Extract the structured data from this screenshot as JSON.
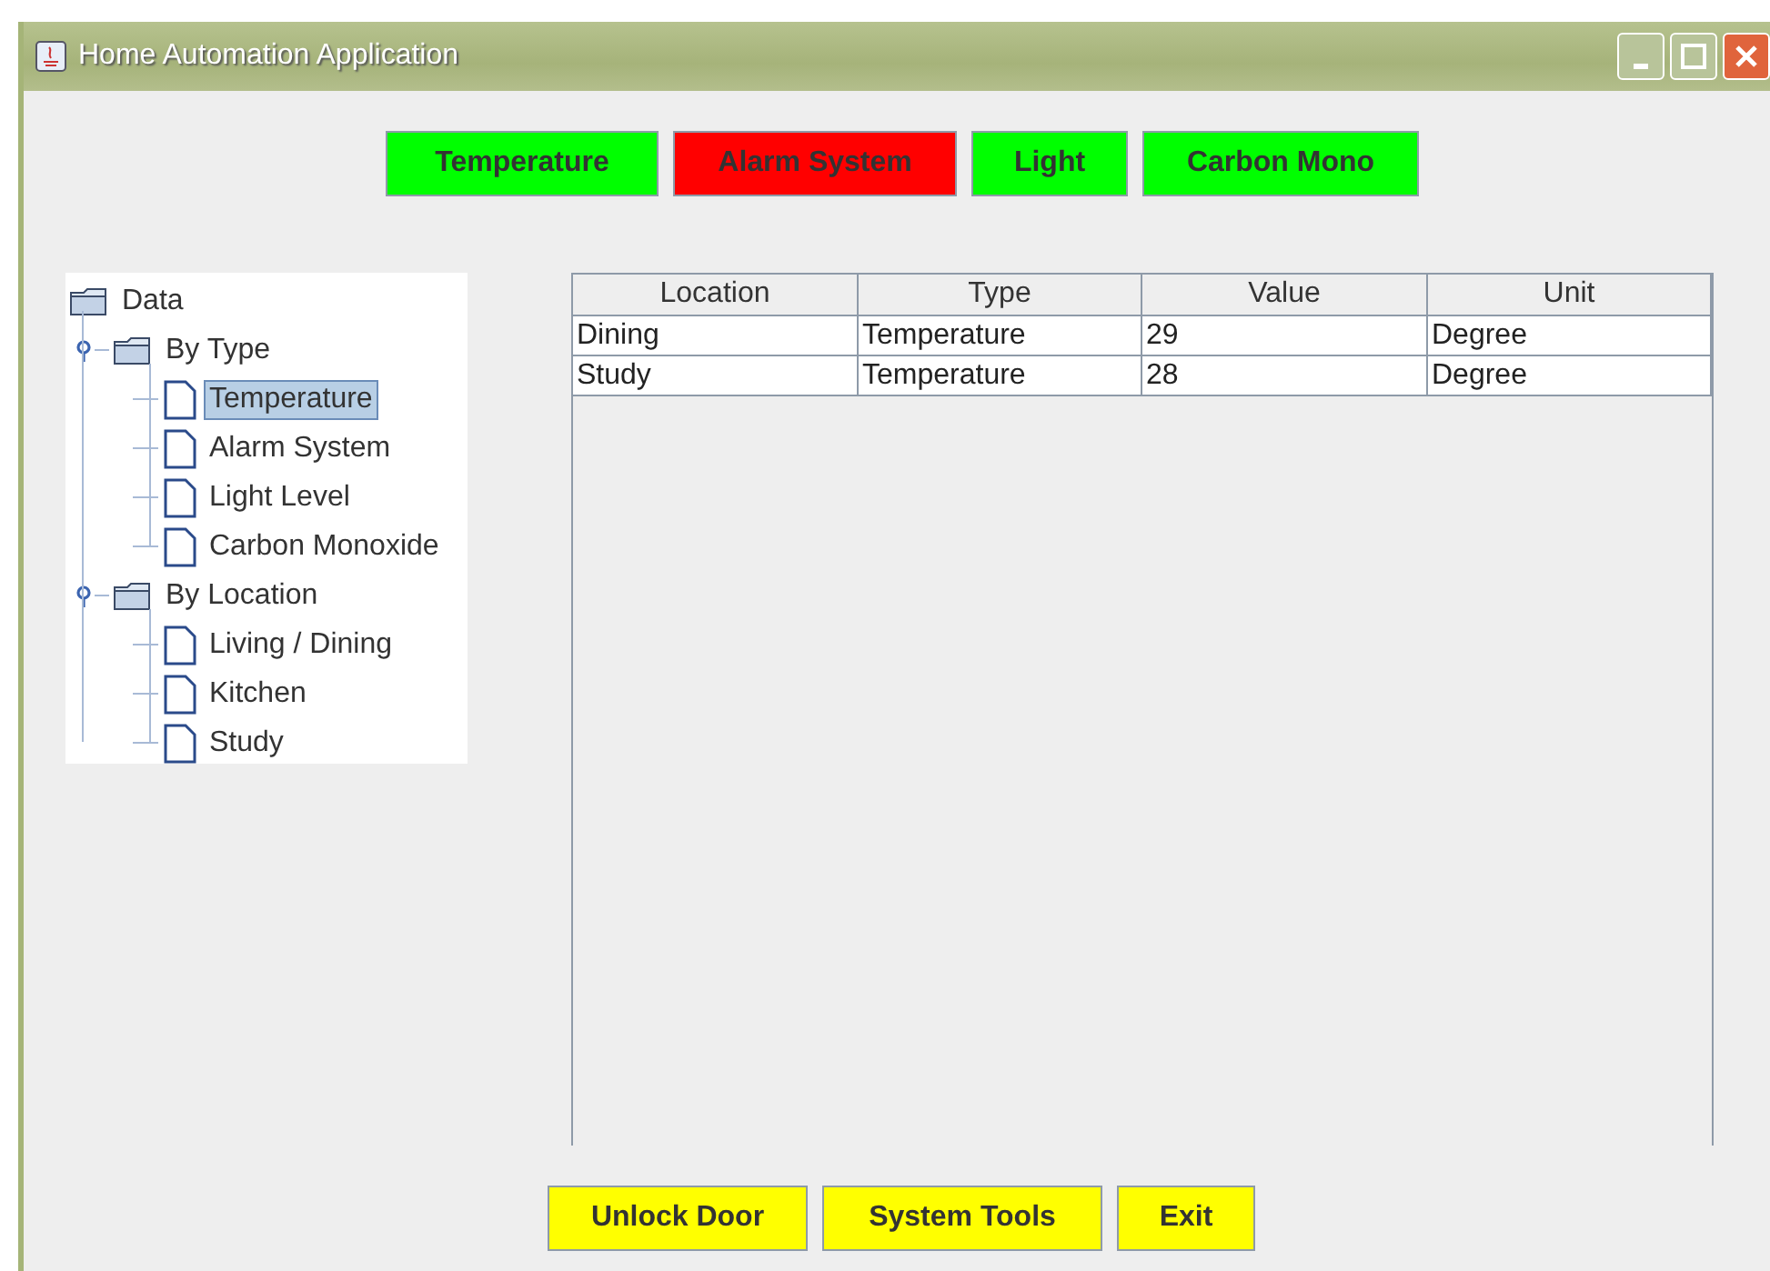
{
  "window": {
    "title": "Home Automation Application"
  },
  "sensor_buttons": [
    {
      "label": "Temperature",
      "color": "#00ff00"
    },
    {
      "label": "Alarm System",
      "color": "#ff0000"
    },
    {
      "label": "Light",
      "color": "#00ff00"
    },
    {
      "label": "Carbon Mono",
      "color": "#00ff00"
    }
  ],
  "tree": {
    "label": "Data",
    "kind": "folder",
    "selected": false,
    "children": [
      {
        "label": "By Type",
        "kind": "folder",
        "selected": false,
        "children": [
          {
            "label": "Temperature",
            "kind": "leaf",
            "selected": true
          },
          {
            "label": "Alarm System",
            "kind": "leaf",
            "selected": false
          },
          {
            "label": "Light Level",
            "kind": "leaf",
            "selected": false
          },
          {
            "label": "Carbon Monoxide",
            "kind": "leaf",
            "selected": false
          }
        ]
      },
      {
        "label": "By Location",
        "kind": "folder",
        "selected": false,
        "children": [
          {
            "label": "Living / Dining",
            "kind": "leaf",
            "selected": false
          },
          {
            "label": "Kitchen",
            "kind": "leaf",
            "selected": false
          },
          {
            "label": "Study",
            "kind": "leaf",
            "selected": false
          }
        ]
      }
    ]
  },
  "table": {
    "columns": [
      "Location",
      "Type",
      "Value",
      "Unit"
    ],
    "rows": [
      [
        "Dining",
        "Temperature",
        "29",
        "Degree"
      ],
      [
        "Study",
        "Temperature",
        "28",
        "Degree"
      ]
    ]
  },
  "bottom_buttons": [
    "Unlock Door",
    "System Tools",
    "Exit"
  ]
}
